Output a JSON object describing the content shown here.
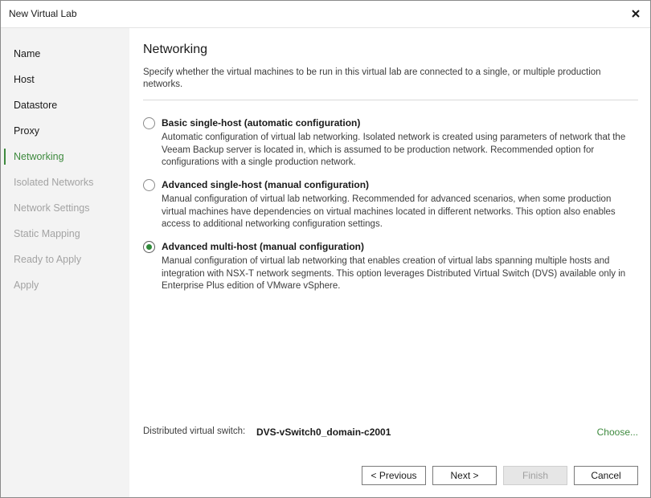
{
  "window": {
    "title": "New Virtual Lab"
  },
  "sidebar": {
    "items": [
      {
        "label": "Name",
        "state": "normal"
      },
      {
        "label": "Host",
        "state": "normal"
      },
      {
        "label": "Datastore",
        "state": "normal"
      },
      {
        "label": "Proxy",
        "state": "normal"
      },
      {
        "label": "Networking",
        "state": "active"
      },
      {
        "label": "Isolated Networks",
        "state": "disabled"
      },
      {
        "label": "Network Settings",
        "state": "disabled"
      },
      {
        "label": "Static Mapping",
        "state": "disabled"
      },
      {
        "label": "Ready to Apply",
        "state": "disabled"
      },
      {
        "label": "Apply",
        "state": "disabled"
      }
    ]
  },
  "main": {
    "title": "Networking",
    "description": "Specify whether the virtual machines to be run in this virtual lab are connected to a single, or multiple production networks.",
    "options": [
      {
        "label": "Basic single-host (automatic configuration)",
        "description": "Automatic configuration of virtual lab networking. Isolated network is created using parameters of network that the Veeam Backup server is located in, which is assumed to be production network. Recommended option for configurations with a single production network.",
        "selected": false
      },
      {
        "label": "Advanced single-host (manual configuration)",
        "description": "Manual configuration of virtual lab networking. Recommended for advanced scenarios, when some production virtual machines have dependencies on virtual machines located in different networks. This option also enables access to additional networking configuration settings.",
        "selected": false
      },
      {
        "label": "Advanced multi-host (manual configuration)",
        "description": "Manual configuration of virtual lab networking that enables creation of virtual labs spanning multiple hosts and integration with NSX-T network segments. This option leverages Distributed Virtual Switch (DVS) available only in Enterprise Plus edition of VMware vSphere.",
        "selected": true
      }
    ],
    "dvs": {
      "label": "Distributed virtual switch:",
      "value": "DVS-vSwitch0_domain-c2001",
      "choose_label": "Choose..."
    }
  },
  "buttons": {
    "previous": "< Previous",
    "next": "Next >",
    "finish": "Finish",
    "cancel": "Cancel"
  },
  "colors": {
    "accent": "#3e8a3e",
    "radio_selected": "#2f8a3a",
    "sidebar_bg": "#f3f3f3",
    "disabled_text": "#a3a3a3"
  }
}
